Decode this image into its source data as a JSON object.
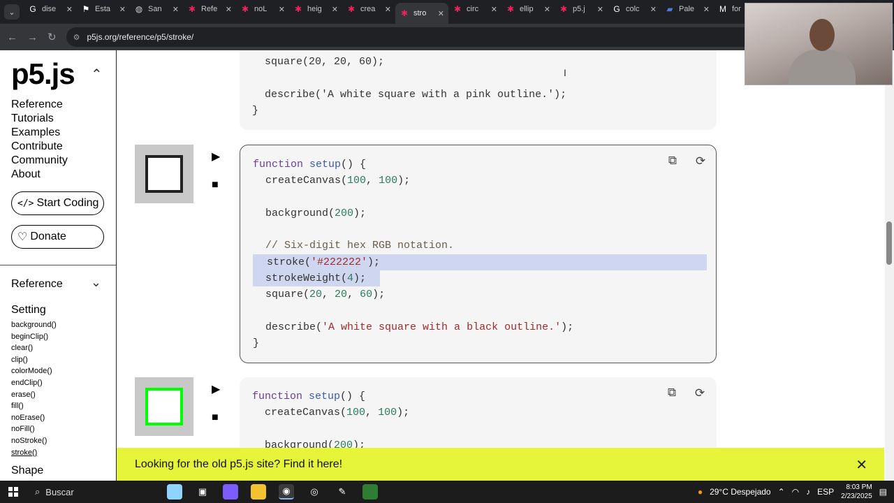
{
  "browser": {
    "tabs": [
      {
        "title": "dise",
        "icon": "google-icon",
        "active": false
      },
      {
        "title": "Esta",
        "icon": "site-icon",
        "active": false
      },
      {
        "title": "San",
        "icon": "globe-icon",
        "active": false
      },
      {
        "title": "Refe",
        "icon": "p5-icon",
        "active": false
      },
      {
        "title": "noL",
        "icon": "p5-icon",
        "active": false
      },
      {
        "title": "heig",
        "icon": "p5-icon",
        "active": false
      },
      {
        "title": "crea",
        "icon": "p5-icon",
        "active": false
      },
      {
        "title": "stro",
        "icon": "p5-icon",
        "active": true
      },
      {
        "title": "circ",
        "icon": "p5-icon",
        "active": false
      },
      {
        "title": "ellip",
        "icon": "p5-icon",
        "active": false
      },
      {
        "title": "p5.j",
        "icon": "p5-icon",
        "active": false
      },
      {
        "title": "colc",
        "icon": "google-icon",
        "active": false
      },
      {
        "title": "Pale",
        "icon": "doc-icon",
        "active": false
      },
      {
        "title": "for",
        "icon": "m-icon",
        "active": false
      }
    ],
    "url": "p5js.org/reference/p5/stroke/"
  },
  "sidebar": {
    "logo": "p5.js",
    "nav": [
      "Reference",
      "Tutorials",
      "Examples",
      "Contribute",
      "Community",
      "About"
    ],
    "start_coding": "Start Coding",
    "donate": "Donate",
    "reference_heading": "Reference",
    "section_setting": "Setting",
    "functions": [
      "background()",
      "beginClip()",
      "clear()",
      "clip()",
      "colorMode()",
      "endClip()",
      "erase()",
      "fill()",
      "noErase()",
      "noFill()",
      "noStroke()",
      "stroke()"
    ],
    "current_function": "stroke()",
    "section_shape": "Shape"
  },
  "examples": {
    "top_lines": {
      "l1": "  square(20, 20, 60);",
      "l2": "  describe('A white square with a pink outline.');",
      "l3": "}"
    },
    "ex2": {
      "l1": "function setup() {",
      "l2": "  createCanvas(100, 100);",
      "l3": "  background(200);",
      "l4": "  // Six-digit hex RGB notation.",
      "l5": "stroke('#222222');",
      "l6": "  strokeWeight(4);",
      "l7": "  square(20, 20, 60);",
      "l8": "  describe('A white square with a black outline.');",
      "l9": "}",
      "stroke_color": "#222222"
    },
    "ex3": {
      "l1": "function setup() {",
      "l2": "  createCanvas(100, 100);",
      "l3": "  background(200);",
      "stroke_color": "#00ff00"
    }
  },
  "banner": {
    "text": "Looking for the old p5.js site? Find it here!"
  },
  "taskbar": {
    "search": "Buscar",
    "weather": "29°C  Despejado",
    "lang": "ESP",
    "time": "8:03 PM",
    "date": "2/23/2025"
  }
}
